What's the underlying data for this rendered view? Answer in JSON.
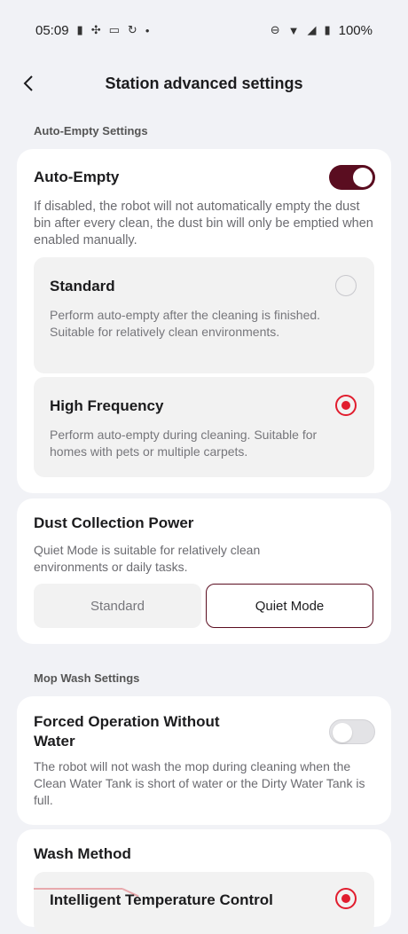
{
  "status_bar": {
    "time": "05:09",
    "battery": "100%",
    "icons_left": [
      "sim-icon",
      "fan-icon",
      "card-icon",
      "sync-icon",
      "dot-icon"
    ],
    "icons_right": [
      "dnd-icon",
      "wifi-icon",
      "signal-icon",
      "battery-icon"
    ]
  },
  "header": {
    "title": "Station advanced settings"
  },
  "auto_empty_section": {
    "label": "Auto-Empty Settings",
    "card": {
      "title": "Auto-Empty",
      "toggle_on": true,
      "description": "If disabled, the robot will not automatically empty the dust bin after every clean, the dust bin will only be emptied when enabled manually.",
      "options": [
        {
          "title": "Standard",
          "description": "Perform auto-empty after the cleaning is finished. Suitable for relatively clean environments.",
          "selected": false
        },
        {
          "title": "High Frequency",
          "description": "Perform auto-empty during cleaning. Suitable for homes with pets or multiple carpets.",
          "selected": true
        }
      ]
    }
  },
  "dust_power": {
    "title": "Dust Collection Power",
    "description": "Quiet Mode is suitable for relatively clean environments or daily tasks.",
    "buttons": [
      "Standard",
      "Quiet Mode"
    ],
    "selected": "Quiet Mode"
  },
  "mop_wash_section": {
    "label": "Mop Wash Settings",
    "forced_operation": {
      "title": "Forced Operation Without Water",
      "toggle_on": false,
      "description": "The robot will not wash the mop during cleaning when the Clean Water Tank is short of water or the Dirty Water Tank is full."
    },
    "wash_method": {
      "title": "Wash Method",
      "option_title": "Intelligent Temperature Control",
      "selected": true
    }
  },
  "colors": {
    "accent": "#5a0d20",
    "radio_selected": "#e11d2e",
    "background": "#f1f2f6"
  }
}
